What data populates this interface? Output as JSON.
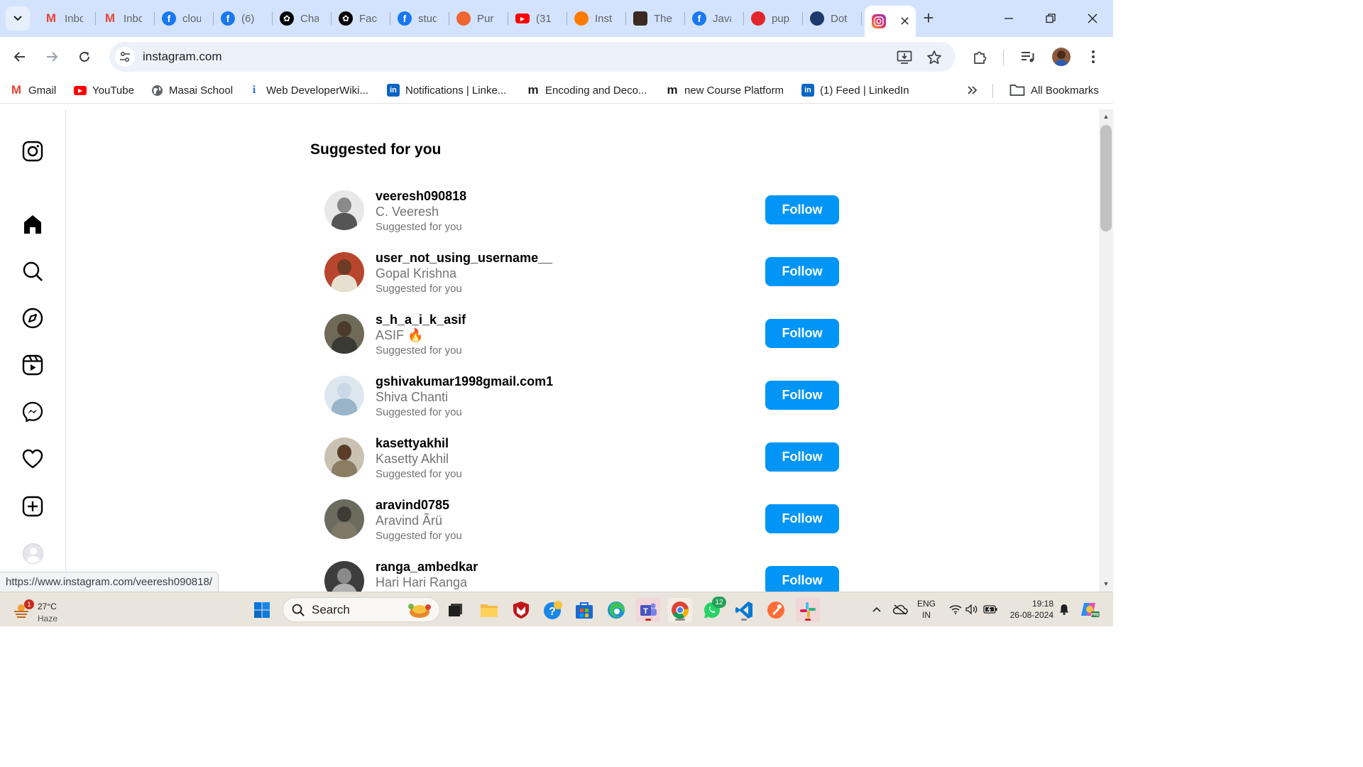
{
  "browser": {
    "tabs": [
      {
        "title": "Inbox",
        "icon": "gmail-icon",
        "color": "#ea4335"
      },
      {
        "title": "Inbox",
        "icon": "gmail-icon",
        "color": "#ea4335"
      },
      {
        "title": "cloud",
        "icon": "facebook-icon",
        "color": "#1877f2"
      },
      {
        "title": "(6)",
        "icon": "facebook-icon",
        "color": "#1877f2"
      },
      {
        "title": "ChatGPT",
        "icon": "chatgpt-icon",
        "color": "#000000"
      },
      {
        "title": "Face",
        "icon": "chatgpt-icon",
        "color": "#000000"
      },
      {
        "title": "stud",
        "icon": "facebook-icon",
        "color": "#1877f2"
      },
      {
        "title": "Pur",
        "icon": "app-icon",
        "color": "#f06532"
      },
      {
        "title": "(31",
        "icon": "youtube-icon",
        "color": "#ff0000"
      },
      {
        "title": "Inst",
        "icon": "app-icon",
        "color": "#ff7a00"
      },
      {
        "title": "The",
        "icon": "person-icon",
        "color": "#3a2a22"
      },
      {
        "title": "Java",
        "icon": "facebook-icon",
        "color": "#1877f2"
      },
      {
        "title": "pup",
        "icon": "app-icon",
        "color": "#e3252c"
      },
      {
        "title": "Dot",
        "icon": "app-icon",
        "color": "#1c3a6b"
      }
    ],
    "active_tab": {
      "title": "Instagram",
      "icon": "instagram-icon"
    },
    "url": "instagram.com"
  },
  "bookmarks": [
    {
      "label": "Gmail",
      "icon": "gmail-icon",
      "color": "#ea4335"
    },
    {
      "label": "YouTube",
      "icon": "youtube-icon",
      "color": "#ff0000"
    },
    {
      "label": "Masai School",
      "icon": "globe-icon",
      "color": "#5f6368"
    },
    {
      "label": "Web DeveloperWiki...",
      "icon": "info-icon",
      "color": "#1a73e8"
    },
    {
      "label": "Notifications | Linke...",
      "icon": "linkedin-icon",
      "color": "#0a66c2"
    },
    {
      "label": "Encoding and Deco...",
      "icon": "m-icon",
      "color": "#1f1f1f"
    },
    {
      "label": "new Course Platform",
      "icon": "m-icon",
      "color": "#1f1f1f"
    },
    {
      "label": "(1) Feed | LinkedIn",
      "icon": "linkedin-icon",
      "color": "#0a66c2"
    }
  ],
  "all_bookmarks_label": "All Bookmarks",
  "page": {
    "heading": "Suggested for you",
    "follow_label": "Follow",
    "accent": "#0095f6",
    "suggestions": [
      {
        "username": "veeresh090818",
        "name": "C. Veeresh",
        "subtitle": "Suggested for you"
      },
      {
        "username": "user_not_using_username__",
        "name": "Gopal Krishna",
        "subtitle": "Suggested for you"
      },
      {
        "username": "s_h_a_i_k_asif",
        "name": "ASIF 🔥",
        "subtitle": "Suggested for you"
      },
      {
        "username": "gshivakumar1998gmail.com1",
        "name": "Shiva Chanti",
        "subtitle": "Suggested for you"
      },
      {
        "username": "kasettyakhil",
        "name": "Kasetty Akhil",
        "subtitle": "Suggested for you"
      },
      {
        "username": "aravind0785",
        "name": "Aravind Ãrü",
        "subtitle": "Suggested for you"
      },
      {
        "username": "ranga_ambedkar",
        "name": "Hari Hari Ranga",
        "subtitle": ""
      }
    ]
  },
  "status_url": "https://www.instagram.com/veeresh090818/",
  "taskbar": {
    "weather_temp": "27°C",
    "weather_cond": "Haze",
    "weather_badge": "1",
    "search_label": "Search",
    "whatsapp_badge": "12",
    "lang_line1": "ENG",
    "lang_line2": "IN",
    "time": "19:18",
    "date": "26-08-2024"
  }
}
